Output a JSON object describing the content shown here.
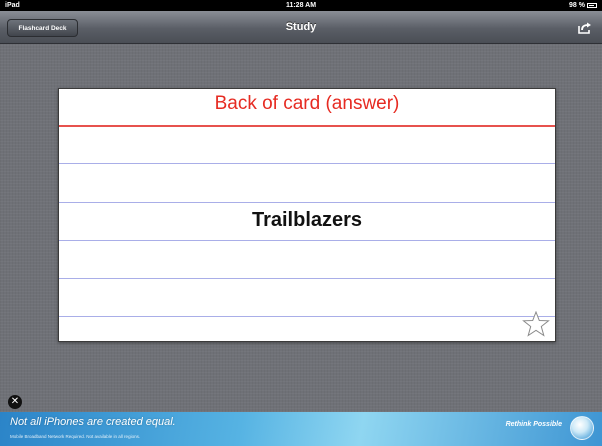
{
  "status_bar": {
    "device": "iPad",
    "time": "11:28 AM",
    "battery": "98 %"
  },
  "nav": {
    "title": "Study",
    "back_label": "Flashcard Deck",
    "share_icon": "share-icon"
  },
  "card": {
    "header": "Back of card (answer)",
    "term": "Trailblazers",
    "star_icon": "star-outline-icon",
    "colors": {
      "header": "#e62b22",
      "red_rule": "#e7524d",
      "blue_rule": "#a9aee8"
    }
  },
  "ad": {
    "headline": "Not all iPhones are created equal.",
    "fine_print": "Mobile Broadband Network Required. Not available in all regions.",
    "brand": "Rethink Possible",
    "close_icon": "close-icon",
    "logo_icon": "globe-logo-icon"
  }
}
